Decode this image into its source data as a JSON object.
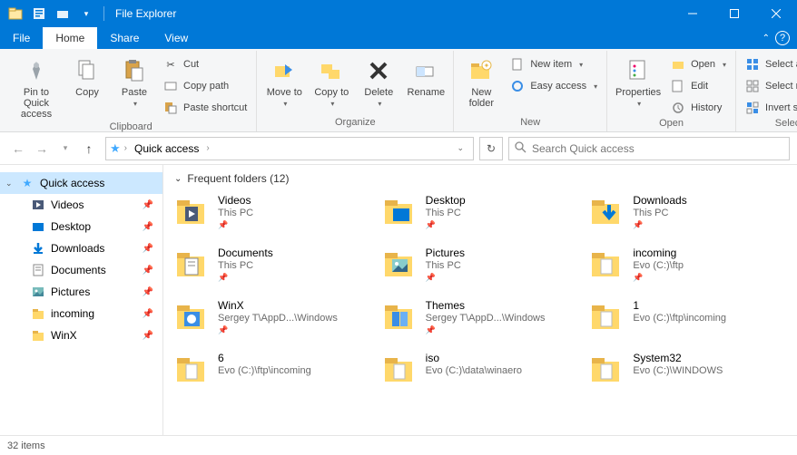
{
  "titlebar": {
    "title": "File Explorer"
  },
  "tabs": {
    "file": "File",
    "home": "Home",
    "share": "Share",
    "view": "View"
  },
  "ribbon": {
    "clipboard": {
      "label": "Clipboard",
      "pin": "Pin to Quick access",
      "copy": "Copy",
      "paste": "Paste",
      "cut": "Cut",
      "copy_path": "Copy path",
      "paste_shortcut": "Paste shortcut"
    },
    "organize": {
      "label": "Organize",
      "move_to": "Move to",
      "copy_to": "Copy to",
      "delete": "Delete",
      "rename": "Rename"
    },
    "new": {
      "label": "New",
      "new_folder": "New folder",
      "new_item": "New item",
      "easy_access": "Easy access"
    },
    "open": {
      "label": "Open",
      "properties": "Properties",
      "open": "Open",
      "edit": "Edit",
      "history": "History"
    },
    "select": {
      "label": "Select",
      "select_all": "Select all",
      "select_none": "Select none",
      "invert": "Invert selection"
    }
  },
  "nav": {
    "crumb": "Quick access",
    "search_placeholder": "Search Quick access"
  },
  "sidebar": {
    "header": "Quick access",
    "items": [
      {
        "label": "Videos"
      },
      {
        "label": "Desktop"
      },
      {
        "label": "Downloads"
      },
      {
        "label": "Documents"
      },
      {
        "label": "Pictures"
      },
      {
        "label": "incoming"
      },
      {
        "label": "WinX"
      }
    ]
  },
  "content": {
    "section_label": "Frequent folders (12)",
    "folders": [
      {
        "name": "Videos",
        "loc": "This PC",
        "pinned": true
      },
      {
        "name": "Desktop",
        "loc": "This PC",
        "pinned": true
      },
      {
        "name": "Downloads",
        "loc": "This PC",
        "pinned": true
      },
      {
        "name": "Documents",
        "loc": "This PC",
        "pinned": true
      },
      {
        "name": "Pictures",
        "loc": "This PC",
        "pinned": true
      },
      {
        "name": "incoming",
        "loc": "Evo (C:)\\ftp",
        "pinned": true
      },
      {
        "name": "WinX",
        "loc": "Sergey T\\AppD...\\Windows",
        "pinned": true
      },
      {
        "name": "Themes",
        "loc": "Sergey T\\AppD...\\Windows",
        "pinned": true
      },
      {
        "name": "1",
        "loc": "Evo (C:)\\ftp\\incoming",
        "pinned": false
      },
      {
        "name": "6",
        "loc": "Evo (C:)\\ftp\\incoming",
        "pinned": false
      },
      {
        "name": "iso",
        "loc": "Evo (C:)\\data\\winaero",
        "pinned": false
      },
      {
        "name": "System32",
        "loc": "Evo (C:)\\WINDOWS",
        "pinned": false
      }
    ]
  },
  "status": {
    "text": "32 items"
  }
}
